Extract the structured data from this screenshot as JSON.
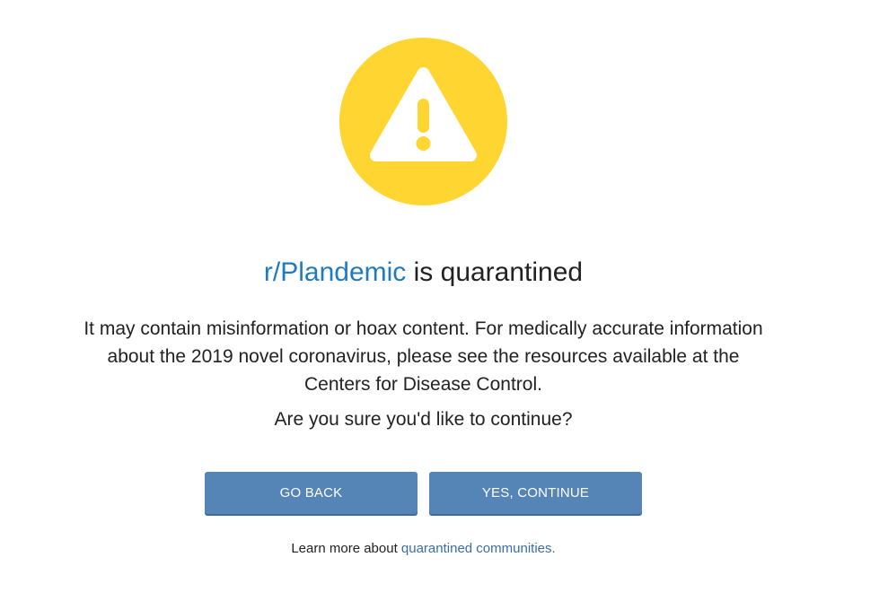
{
  "icon": {
    "name": "warning-icon",
    "badge_color": "#fed531"
  },
  "heading": {
    "subreddit": "r/Plandemic",
    "suffix": " is quarantined"
  },
  "message": {
    "line1": "It may contain misinformation or hoax content. For medically accurate information",
    "line2": "about the 2019 novel coronavirus, please see the resources available at the",
    "line3": "Centers for Disease Control.",
    "confirm": "Are you sure you'd like to continue?"
  },
  "buttons": {
    "back_label": "GO BACK",
    "continue_label": "YES, CONTINUE",
    "color": "#5585b7"
  },
  "footer": {
    "prefix": "Learn more about ",
    "link": "quarantined communities",
    "suffix": "."
  },
  "colors": {
    "link": "#1f7bc1",
    "text": "#222222"
  }
}
